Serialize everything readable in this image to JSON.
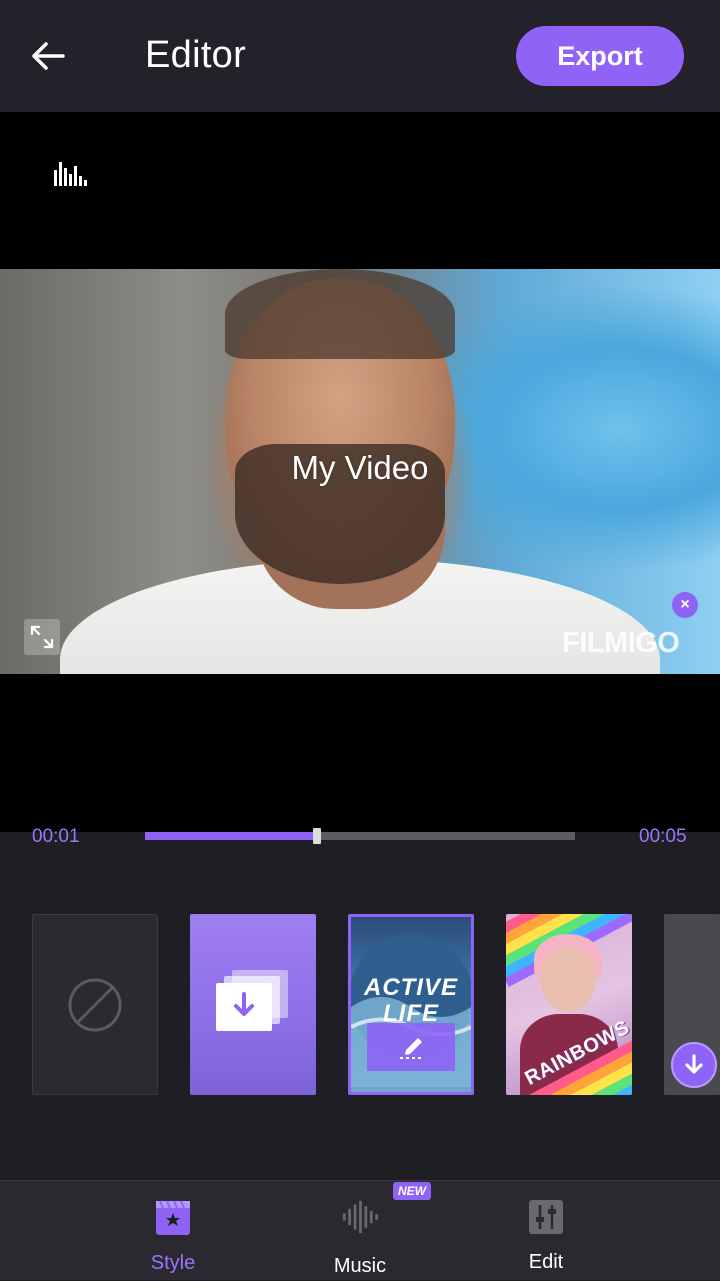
{
  "header": {
    "title": "Editor",
    "export_label": "Export"
  },
  "preview": {
    "video_title": "My Video",
    "watermark": "FILMIGO"
  },
  "timeline": {
    "current_time": "00:01",
    "total_time": "00:05",
    "progress": 0.4
  },
  "styles": {
    "items": [
      {
        "name": "none"
      },
      {
        "name": "download"
      },
      {
        "name": "active-life",
        "text": "ACTIVE LIFE",
        "selected": true
      },
      {
        "name": "rainbows",
        "text": "RAINBOWS"
      },
      {
        "name": "more"
      }
    ]
  },
  "bottom_nav": {
    "items": [
      {
        "label": "Style",
        "icon": "style-clapper-icon",
        "active": true
      },
      {
        "label": "Music",
        "icon": "music-waveform-icon",
        "badge": "NEW"
      },
      {
        "label": "Edit",
        "icon": "edit-sliders-icon"
      }
    ]
  },
  "colors": {
    "accent": "#8e63f5",
    "background": "#1f1e25",
    "topbar": "#23222a",
    "nav_background": "#2a2930"
  }
}
